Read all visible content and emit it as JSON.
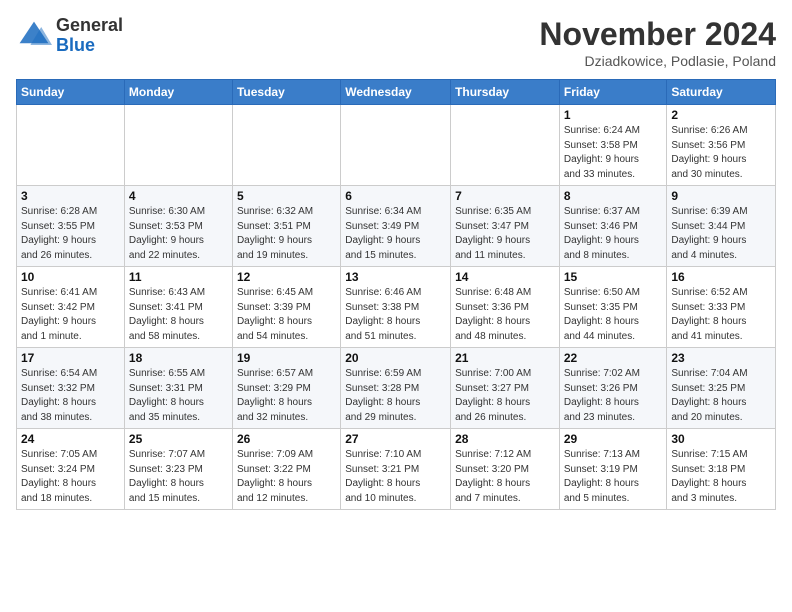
{
  "header": {
    "logo_general": "General",
    "logo_blue": "Blue",
    "month_title": "November 2024",
    "location": "Dziadkowice, Podlasie, Poland"
  },
  "weekdays": [
    "Sunday",
    "Monday",
    "Tuesday",
    "Wednesday",
    "Thursday",
    "Friday",
    "Saturday"
  ],
  "weeks": [
    [
      {
        "day": "",
        "info": ""
      },
      {
        "day": "",
        "info": ""
      },
      {
        "day": "",
        "info": ""
      },
      {
        "day": "",
        "info": ""
      },
      {
        "day": "",
        "info": ""
      },
      {
        "day": "1",
        "info": "Sunrise: 6:24 AM\nSunset: 3:58 PM\nDaylight: 9 hours\nand 33 minutes."
      },
      {
        "day": "2",
        "info": "Sunrise: 6:26 AM\nSunset: 3:56 PM\nDaylight: 9 hours\nand 30 minutes."
      }
    ],
    [
      {
        "day": "3",
        "info": "Sunrise: 6:28 AM\nSunset: 3:55 PM\nDaylight: 9 hours\nand 26 minutes."
      },
      {
        "day": "4",
        "info": "Sunrise: 6:30 AM\nSunset: 3:53 PM\nDaylight: 9 hours\nand 22 minutes."
      },
      {
        "day": "5",
        "info": "Sunrise: 6:32 AM\nSunset: 3:51 PM\nDaylight: 9 hours\nand 19 minutes."
      },
      {
        "day": "6",
        "info": "Sunrise: 6:34 AM\nSunset: 3:49 PM\nDaylight: 9 hours\nand 15 minutes."
      },
      {
        "day": "7",
        "info": "Sunrise: 6:35 AM\nSunset: 3:47 PM\nDaylight: 9 hours\nand 11 minutes."
      },
      {
        "day": "8",
        "info": "Sunrise: 6:37 AM\nSunset: 3:46 PM\nDaylight: 9 hours\nand 8 minutes."
      },
      {
        "day": "9",
        "info": "Sunrise: 6:39 AM\nSunset: 3:44 PM\nDaylight: 9 hours\nand 4 minutes."
      }
    ],
    [
      {
        "day": "10",
        "info": "Sunrise: 6:41 AM\nSunset: 3:42 PM\nDaylight: 9 hours\nand 1 minute."
      },
      {
        "day": "11",
        "info": "Sunrise: 6:43 AM\nSunset: 3:41 PM\nDaylight: 8 hours\nand 58 minutes."
      },
      {
        "day": "12",
        "info": "Sunrise: 6:45 AM\nSunset: 3:39 PM\nDaylight: 8 hours\nand 54 minutes."
      },
      {
        "day": "13",
        "info": "Sunrise: 6:46 AM\nSunset: 3:38 PM\nDaylight: 8 hours\nand 51 minutes."
      },
      {
        "day": "14",
        "info": "Sunrise: 6:48 AM\nSunset: 3:36 PM\nDaylight: 8 hours\nand 48 minutes."
      },
      {
        "day": "15",
        "info": "Sunrise: 6:50 AM\nSunset: 3:35 PM\nDaylight: 8 hours\nand 44 minutes."
      },
      {
        "day": "16",
        "info": "Sunrise: 6:52 AM\nSunset: 3:33 PM\nDaylight: 8 hours\nand 41 minutes."
      }
    ],
    [
      {
        "day": "17",
        "info": "Sunrise: 6:54 AM\nSunset: 3:32 PM\nDaylight: 8 hours\nand 38 minutes."
      },
      {
        "day": "18",
        "info": "Sunrise: 6:55 AM\nSunset: 3:31 PM\nDaylight: 8 hours\nand 35 minutes."
      },
      {
        "day": "19",
        "info": "Sunrise: 6:57 AM\nSunset: 3:29 PM\nDaylight: 8 hours\nand 32 minutes."
      },
      {
        "day": "20",
        "info": "Sunrise: 6:59 AM\nSunset: 3:28 PM\nDaylight: 8 hours\nand 29 minutes."
      },
      {
        "day": "21",
        "info": "Sunrise: 7:00 AM\nSunset: 3:27 PM\nDaylight: 8 hours\nand 26 minutes."
      },
      {
        "day": "22",
        "info": "Sunrise: 7:02 AM\nSunset: 3:26 PM\nDaylight: 8 hours\nand 23 minutes."
      },
      {
        "day": "23",
        "info": "Sunrise: 7:04 AM\nSunset: 3:25 PM\nDaylight: 8 hours\nand 20 minutes."
      }
    ],
    [
      {
        "day": "24",
        "info": "Sunrise: 7:05 AM\nSunset: 3:24 PM\nDaylight: 8 hours\nand 18 minutes."
      },
      {
        "day": "25",
        "info": "Sunrise: 7:07 AM\nSunset: 3:23 PM\nDaylight: 8 hours\nand 15 minutes."
      },
      {
        "day": "26",
        "info": "Sunrise: 7:09 AM\nSunset: 3:22 PM\nDaylight: 8 hours\nand 12 minutes."
      },
      {
        "day": "27",
        "info": "Sunrise: 7:10 AM\nSunset: 3:21 PM\nDaylight: 8 hours\nand 10 minutes."
      },
      {
        "day": "28",
        "info": "Sunrise: 7:12 AM\nSunset: 3:20 PM\nDaylight: 8 hours\nand 7 minutes."
      },
      {
        "day": "29",
        "info": "Sunrise: 7:13 AM\nSunset: 3:19 PM\nDaylight: 8 hours\nand 5 minutes."
      },
      {
        "day": "30",
        "info": "Sunrise: 7:15 AM\nSunset: 3:18 PM\nDaylight: 8 hours\nand 3 minutes."
      }
    ]
  ]
}
